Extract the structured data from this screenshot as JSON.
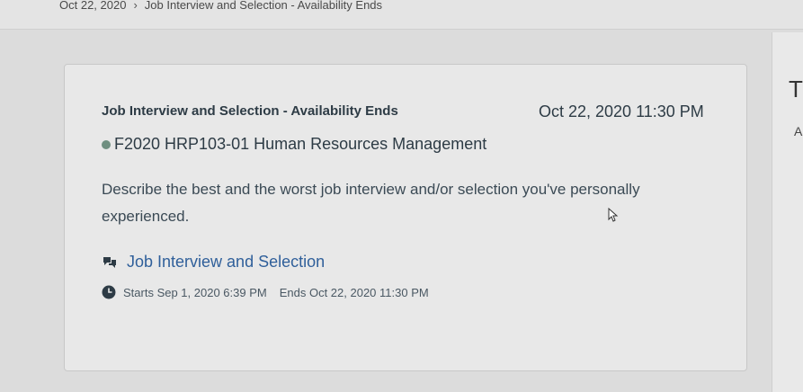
{
  "breadcrumb": {
    "date": "Oct 22, 2020",
    "separator": "›",
    "item": "Job Interview and Selection - Availability Ends"
  },
  "right_panel": {
    "glyph_top": "T",
    "glyph_mid": "A"
  },
  "card": {
    "title": "Job Interview and Selection - Availability Ends",
    "datetime": "Oct 22, 2020 11:30 PM",
    "course": "F2020 HRP103-01 Human Resources Management",
    "course_dot_color": "#6f8f80",
    "description": "Describe the best and the worst job interview and/or selection you've personally experienced.",
    "link": {
      "icon": "discussion-icon",
      "label": "Job Interview and Selection"
    },
    "meta": {
      "icon": "clock-icon",
      "starts": "Starts Sep 1, 2020 6:39 PM",
      "ends": "Ends Oct 22, 2020 11:30 PM"
    }
  }
}
